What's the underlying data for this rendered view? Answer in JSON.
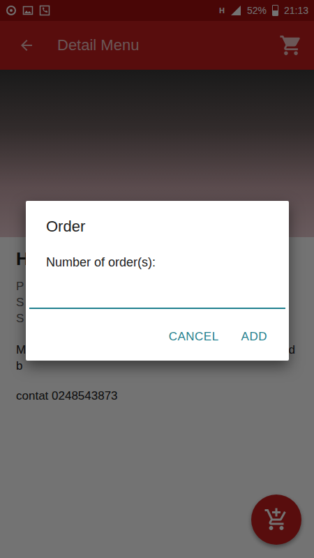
{
  "status_bar": {
    "network": "H",
    "battery": "52%",
    "battery_level": 0.52,
    "time": "21:13"
  },
  "app_bar": {
    "title": "Detail Menu"
  },
  "content": {
    "title": "H",
    "details": [
      "P",
      "S",
      "S"
    ],
    "description": [
      {
        "start": "M",
        "end": "d"
      },
      {
        "start": "b",
        "end": ""
      }
    ],
    "contact": "contat 0248543873"
  },
  "dialog": {
    "title": "Order",
    "label": "Number of order(s):",
    "value": "",
    "buttons": [
      "CANCEL",
      "ADD"
    ]
  }
}
